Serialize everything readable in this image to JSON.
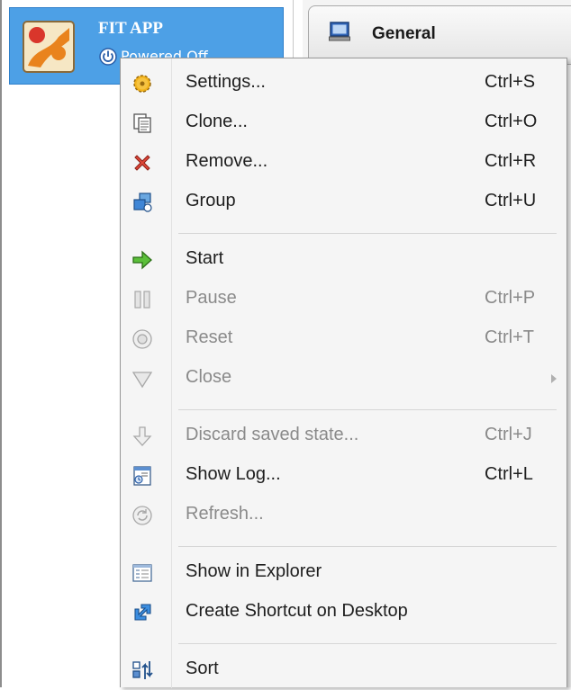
{
  "vm": {
    "name": "FIT APP",
    "state": "Powered Off"
  },
  "details": {
    "section_title": "General"
  },
  "menu": {
    "items": [
      {
        "label": "Settings...",
        "shortcut": "Ctrl+S",
        "icon": "gear-icon",
        "enabled": true
      },
      {
        "label": "Clone...",
        "shortcut": "Ctrl+O",
        "icon": "clone-icon",
        "enabled": true
      },
      {
        "label": "Remove...",
        "shortcut": "Ctrl+R",
        "icon": "remove-icon",
        "enabled": true
      },
      {
        "label": "Group",
        "shortcut": "Ctrl+U",
        "icon": "group-icon",
        "enabled": true
      },
      {
        "label": "Start",
        "shortcut": "",
        "icon": "start-arrow-icon",
        "enabled": true
      },
      {
        "label": "Pause",
        "shortcut": "Ctrl+P",
        "icon": "pause-icon",
        "enabled": false
      },
      {
        "label": "Reset",
        "shortcut": "Ctrl+T",
        "icon": "reset-icon",
        "enabled": false
      },
      {
        "label": "Close",
        "shortcut": "",
        "icon": "close-triangle-icon",
        "enabled": false
      },
      {
        "label": "Discard saved state...",
        "shortcut": "Ctrl+J",
        "icon": "discard-arrow-icon",
        "enabled": false
      },
      {
        "label": "Show Log...",
        "shortcut": "Ctrl+L",
        "icon": "log-icon",
        "enabled": true
      },
      {
        "label": "Refresh...",
        "shortcut": "",
        "icon": "refresh-icon",
        "enabled": false
      },
      {
        "label": "Show in Explorer",
        "shortcut": "",
        "icon": "explorer-icon",
        "enabled": true
      },
      {
        "label": "Create Shortcut on Desktop",
        "shortcut": "",
        "icon": "shortcut-icon",
        "enabled": true
      },
      {
        "label": "Sort",
        "shortcut": "",
        "icon": "sort-icon",
        "enabled": true
      }
    ]
  },
  "colors": {
    "selection": "#4da0e6",
    "menu_bg": "#f5f5f5",
    "disabled_text": "#8a8a8a"
  }
}
